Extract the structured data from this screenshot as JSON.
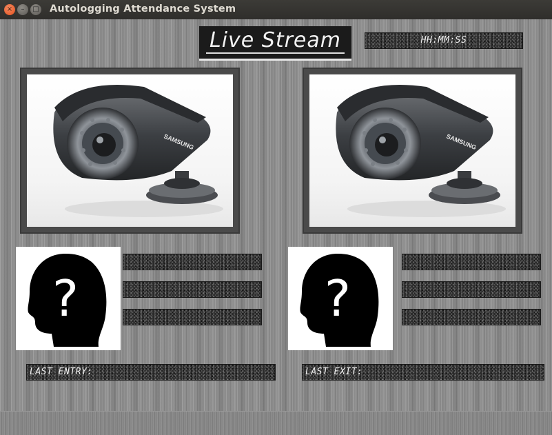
{
  "window": {
    "title": "Autologging Attendance System",
    "buttons": {
      "close": "×",
      "minimize": "–",
      "maximize": "□"
    }
  },
  "header": {
    "live_stream_label": "Live Stream",
    "clock_text": "HH:MM:SS"
  },
  "camera_left": {
    "icon": "cctv-camera-image",
    "brand": "SAMSUNG"
  },
  "camera_right": {
    "icon": "cctv-camera-image",
    "brand": "SAMSUNG"
  },
  "person_left": {
    "icon": "unknown-person-icon",
    "glyph": "?"
  },
  "person_right": {
    "icon": "unknown-person-icon",
    "glyph": "?"
  },
  "info_left": [
    "",
    "",
    ""
  ],
  "info_right": [
    "",
    "",
    ""
  ],
  "footer": {
    "last_entry_label": "LAST ENTRY:",
    "last_exit_label": "LAST EXIT:"
  },
  "colors": {
    "titlebar": "#3c3b37",
    "close_button": "#e4501c",
    "panel_dark": "#2a2a2a",
    "metal": "#8f8f8f"
  }
}
